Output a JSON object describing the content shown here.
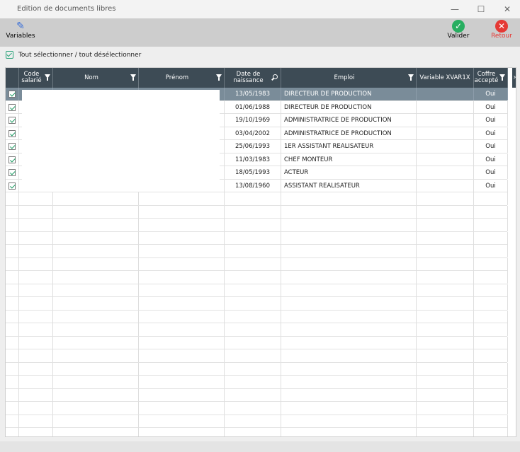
{
  "window": {
    "title": "Edition de documents libres",
    "minimize": "—",
    "maximize": "☐",
    "close": "✕"
  },
  "toolbar": {
    "variables_label": "Variables",
    "valider_label": "Valider",
    "retour_label": "Retour",
    "colors": {
      "valider": "#27ae60",
      "retour": "#e53935"
    },
    "icons": {
      "variables": "pencil-icon",
      "valider": "check-circle-icon",
      "retour": "close-circle-icon"
    }
  },
  "select_all": {
    "label": "Tout sélectionner / tout désélectionner",
    "checked": true
  },
  "table": {
    "columns": [
      "Code salarié",
      "Nom",
      "Prénom",
      "Date de naissance",
      "Emploi",
      "Variable XVAR1X",
      "Coffre accepté"
    ],
    "rows": [
      {
        "checked": true,
        "date": "13/05/1983",
        "emploi": "DIRECTEUR DE PRODUCTION",
        "variable": "",
        "coffre": "Oui",
        "selected": true
      },
      {
        "checked": true,
        "date": "01/06/1988",
        "emploi": "DIRECTEUR DE PRODUCTION",
        "variable": "",
        "coffre": "Oui"
      },
      {
        "checked": true,
        "date": "19/10/1969",
        "emploi": "ADMINISTRATRICE DE PRODUCTION",
        "variable": "",
        "coffre": "Oui"
      },
      {
        "checked": true,
        "date": "03/04/2002",
        "emploi": "ADMINISTRATRICE DE PRODUCTION",
        "variable": "",
        "coffre": "Oui"
      },
      {
        "checked": true,
        "date": "25/06/1993",
        "emploi": "1ER ASSISTANT REALISATEUR",
        "variable": "",
        "coffre": "Oui"
      },
      {
        "checked": true,
        "date": "11/03/1983",
        "emploi": "CHEF MONTEUR",
        "variable": "",
        "coffre": "Oui"
      },
      {
        "checked": true,
        "date": "18/05/1993",
        "emploi": "ACTEUR",
        "variable": "",
        "coffre": "Oui"
      },
      {
        "checked": true,
        "date": "13/08/1960",
        "emploi": "ASSISTANT REALISATEUR",
        "variable": "",
        "coffre": "Oui"
      }
    ]
  }
}
